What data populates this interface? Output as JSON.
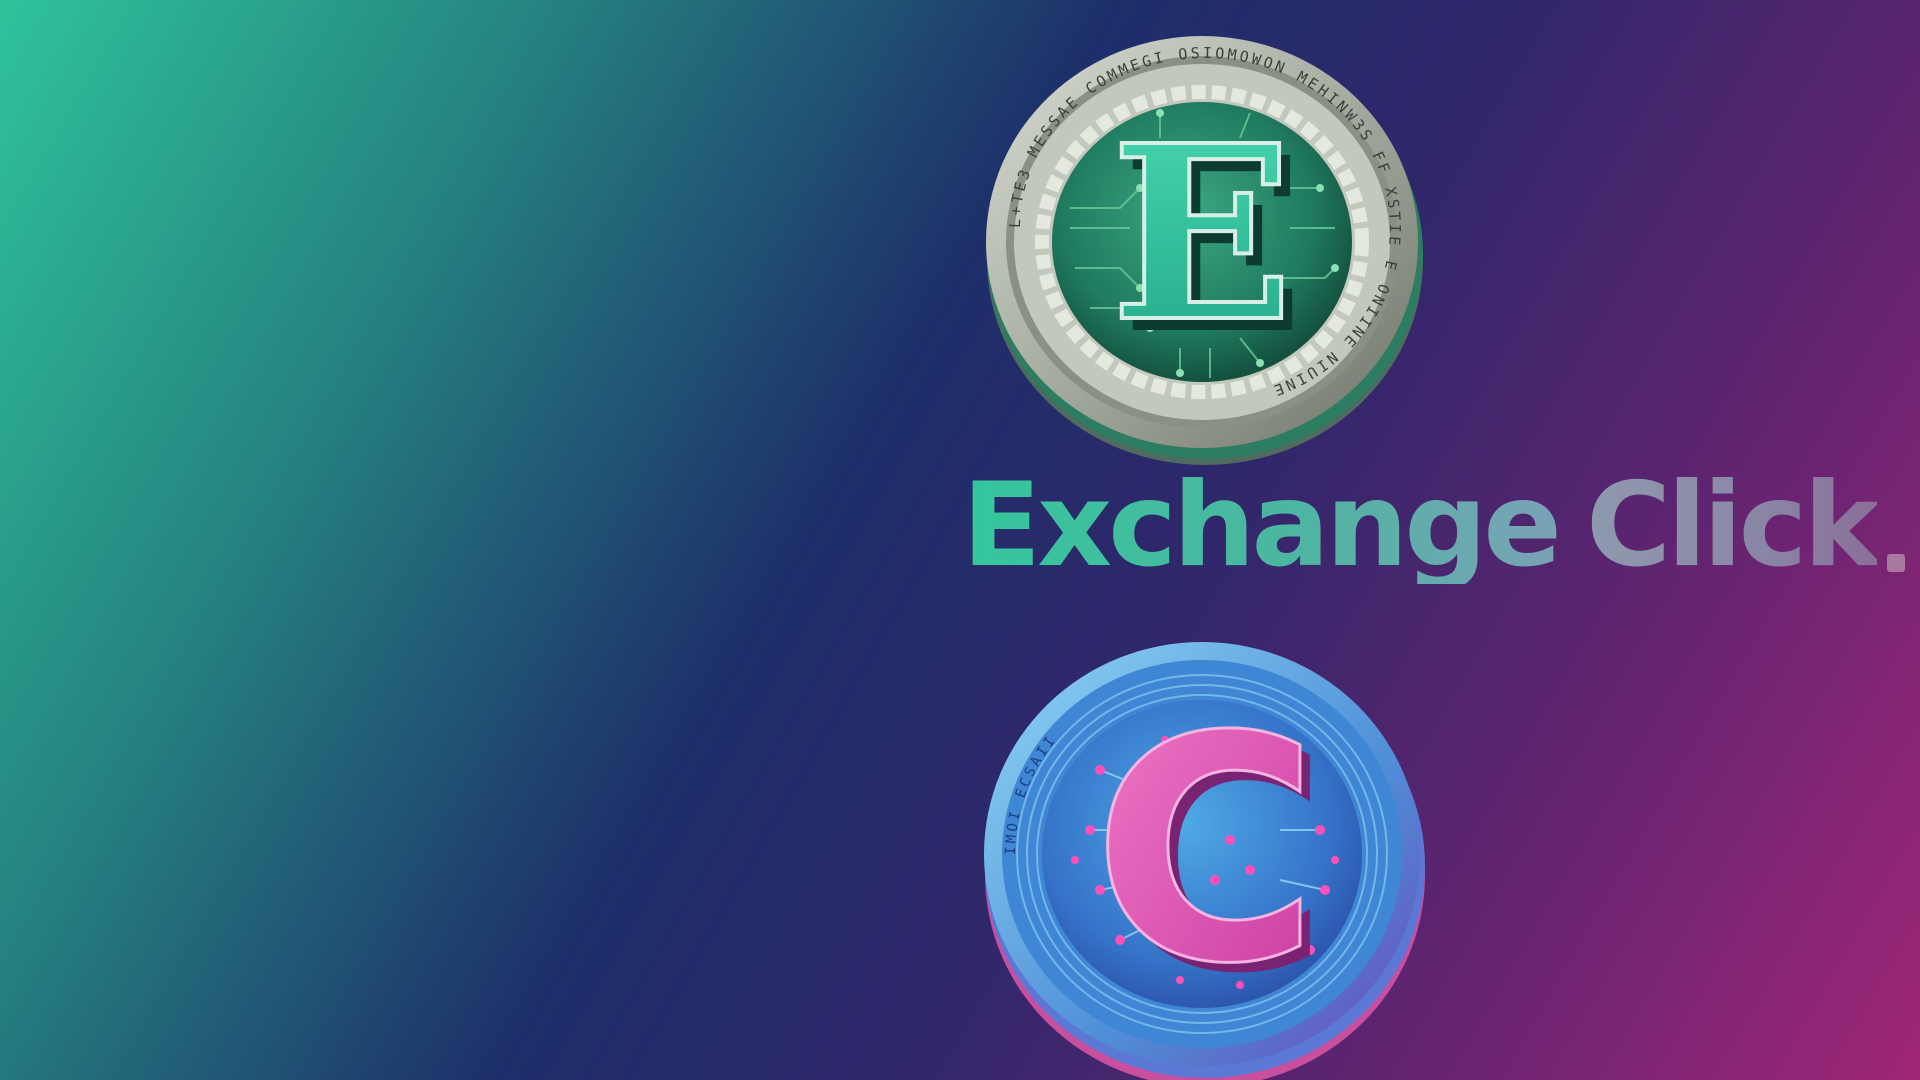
{
  "brand": {
    "word1": "Exchange",
    "word2": "Click",
    "colors": {
      "word1": "#35c79d",
      "word2": "#8f9aae",
      "dot": "#a8799f"
    }
  },
  "coins": {
    "top": {
      "letter": "E",
      "rim_text": "L+TE3 MESSAE COMMEGI OSIOMOWON MEHINW3S FF XSTIE E ONIINE NIUINE",
      "colors": {
        "face": "#2a8f72",
        "letter": "#35c9a1",
        "rim": "#b9bfb3"
      }
    },
    "bottom": {
      "letter": "C",
      "rim_text": "IMOI ECSAII",
      "colors": {
        "face": "#3a7fd0",
        "letter": "#e055b8",
        "rim": "#7ec6f2"
      }
    }
  },
  "background": {
    "colors": [
      "#2fc39b",
      "#1d2f6a",
      "#a02677"
    ]
  }
}
